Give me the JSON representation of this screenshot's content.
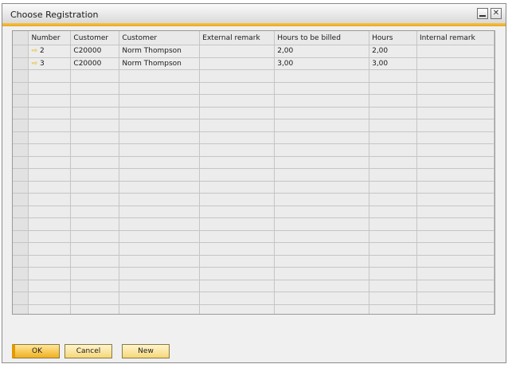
{
  "window": {
    "title": "Choose Registration"
  },
  "columns": [
    "Number",
    "Customer",
    "Customer",
    "External remark",
    "Hours to be billed",
    "Hours",
    "Internal remark"
  ],
  "rows": [
    [
      "2",
      "C20000",
      "Norm Thompson",
      "",
      "2,00",
      "2,00",
      ""
    ],
    [
      "3",
      "C20000",
      "Norm Thompson",
      "",
      "3,00",
      "3,00",
      ""
    ]
  ],
  "buttons": {
    "ok": "OK",
    "cancel": "Cancel",
    "new": "New"
  },
  "icons": {
    "row_link": "golden-arrow-icon",
    "minimize": "minimize-icon",
    "close": "close-icon"
  },
  "colors": {
    "accent": "#f0b020",
    "grid_bg": "#ececec"
  }
}
